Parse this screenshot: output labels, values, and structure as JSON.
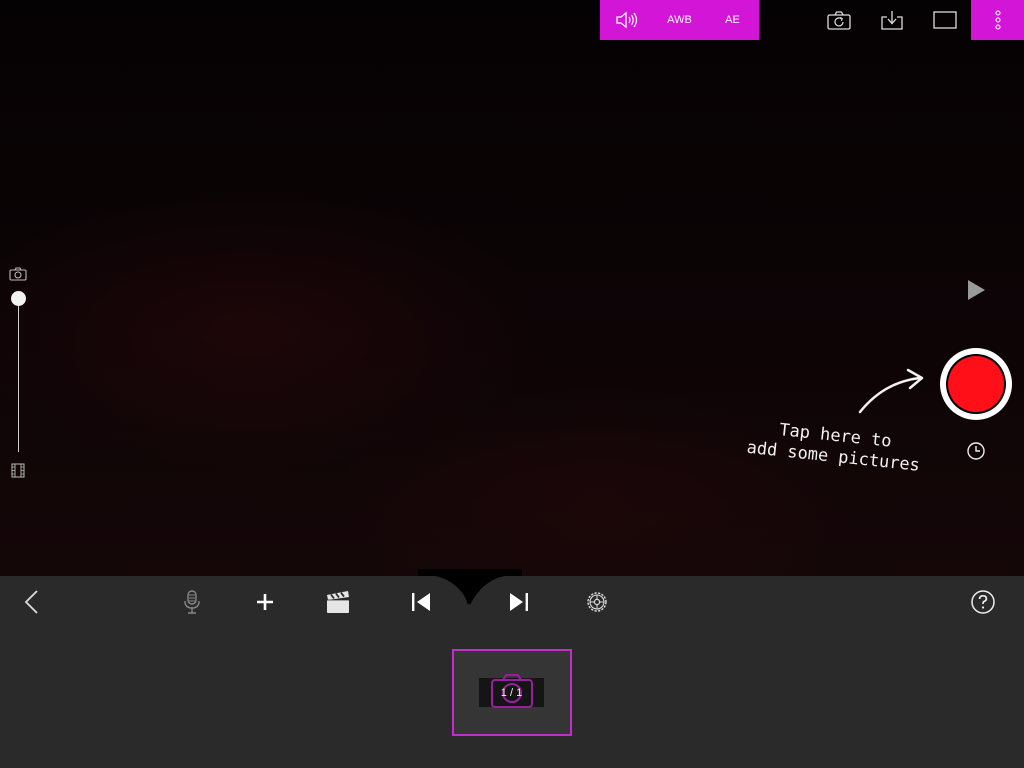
{
  "top_controls": {
    "awb_label": "AWB",
    "ae_label": "AE"
  },
  "hint": {
    "line1": "Tap here to",
    "line2": "add some pictures"
  },
  "frames": [
    {
      "counter": "1 / 1"
    }
  ],
  "colors": {
    "accent": "#d215d6",
    "record": "#ff1019",
    "toolbar": "#2a2a2a",
    "frame_border": "#c030c8"
  },
  "icons": {
    "volume": "volume-icon",
    "rotate_camera": "rotate-camera-icon",
    "import": "import-icon",
    "aspect_ratio": "aspect-ratio-icon",
    "more": "more-vertical-icon",
    "back": "back-arrow-icon",
    "microphone": "microphone-icon",
    "add": "add-icon",
    "clapper": "clapperboard-icon",
    "skip_start": "skip-to-start-icon",
    "skip_end": "skip-to-end-icon",
    "settings": "settings-gear-icon",
    "help": "help-icon"
  }
}
